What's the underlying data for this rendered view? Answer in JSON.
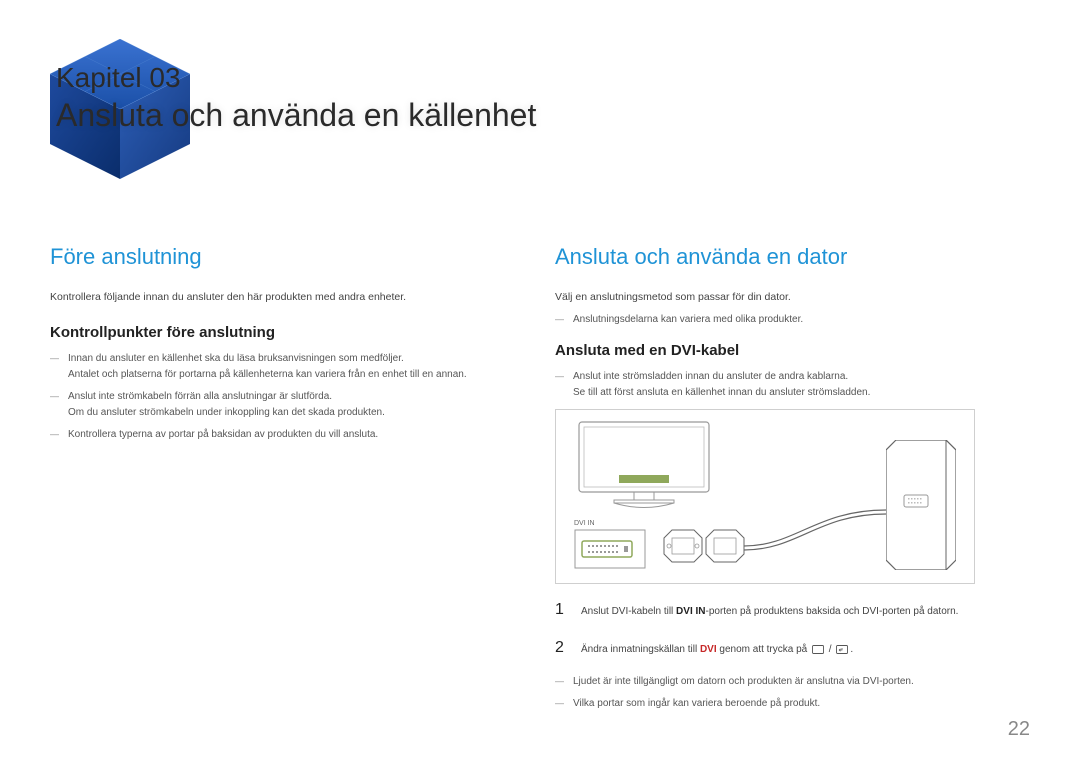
{
  "chapter": {
    "label": "Kapitel 03",
    "title": "Ansluta och använda en källenhet"
  },
  "left": {
    "heading": "Före anslutning",
    "intro": "Kontrollera följande innan du ansluter den här produkten med andra enheter.",
    "subheading": "Kontrollpunkter före anslutning",
    "items": [
      {
        "main": "Innan du ansluter en källenhet ska du läsa bruksanvisningen som medföljer.",
        "sub": "Antalet och platserna för portarna på källenheterna kan variera från en enhet till en annan."
      },
      {
        "main": "Anslut inte strömkabeln förrän alla anslutningar är slutförda.",
        "sub": "Om du ansluter strömkabeln under inkoppling kan det skada produkten."
      },
      {
        "main": "Kontrollera typerna av portar på baksidan av produkten du vill ansluta.",
        "sub": ""
      }
    ]
  },
  "right": {
    "heading": "Ansluta och använda en dator",
    "intro": "Välj en anslutningsmetod som passar för din dator.",
    "note1": "Anslutningsdelarna kan variera med olika produkter.",
    "subheading": "Ansluta med en DVI-kabel",
    "preitems": [
      {
        "main": "Anslut inte strömsladden innan du ansluter de andra kablarna.",
        "sub": "Se till att först ansluta en källenhet innan du ansluter strömsladden."
      }
    ],
    "port_label": "DVI IN",
    "steps": [
      {
        "num": "1",
        "pre": "Anslut DVI-kabeln till ",
        "bold": "DVI IN",
        "post": "-porten på produktens baksida och DVI-porten på datorn."
      },
      {
        "num": "2",
        "pre": "Ändra inmatningskällan till ",
        "red": "DVI",
        "post": " genom att trycka på "
      }
    ],
    "footnotes": [
      "Ljudet är inte tillgängligt om datorn och produkten är anslutna via DVI-porten.",
      "Vilka portar som ingår kan variera beroende på produkt."
    ]
  },
  "page_number": "22"
}
